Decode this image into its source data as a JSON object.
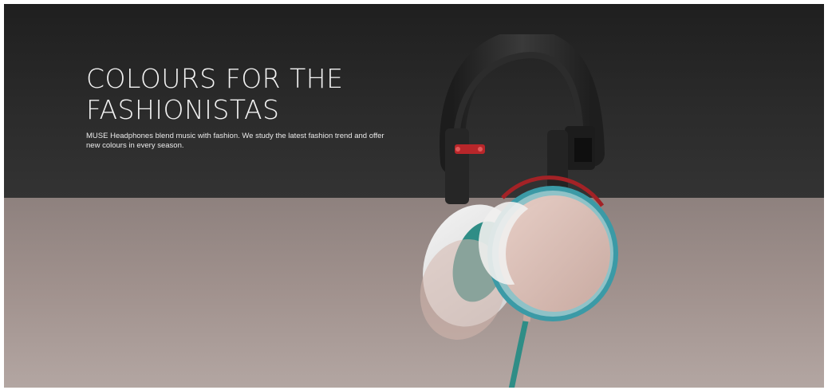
{
  "hero": {
    "title_line1": "COLOURS FOR THE",
    "title_line2": "FASHIONISTAS",
    "description": "MUSE Headphones blend music with fashion. We study the latest fashion trend and offer new colours in every season."
  },
  "product_image": {
    "icon": "headphones-product-image",
    "colors": {
      "headband": "#2a2a2a",
      "accent_red": "#c0282b",
      "earcup_pink": "#d8bcb3",
      "earcup_ring_teal": "#3b9aa6",
      "cushion_white": "#ecebeb",
      "cable_teal": "#2f8d86"
    }
  },
  "colors": {
    "top_band": "#2b2b2b",
    "bottom_band": "#a1928e"
  }
}
